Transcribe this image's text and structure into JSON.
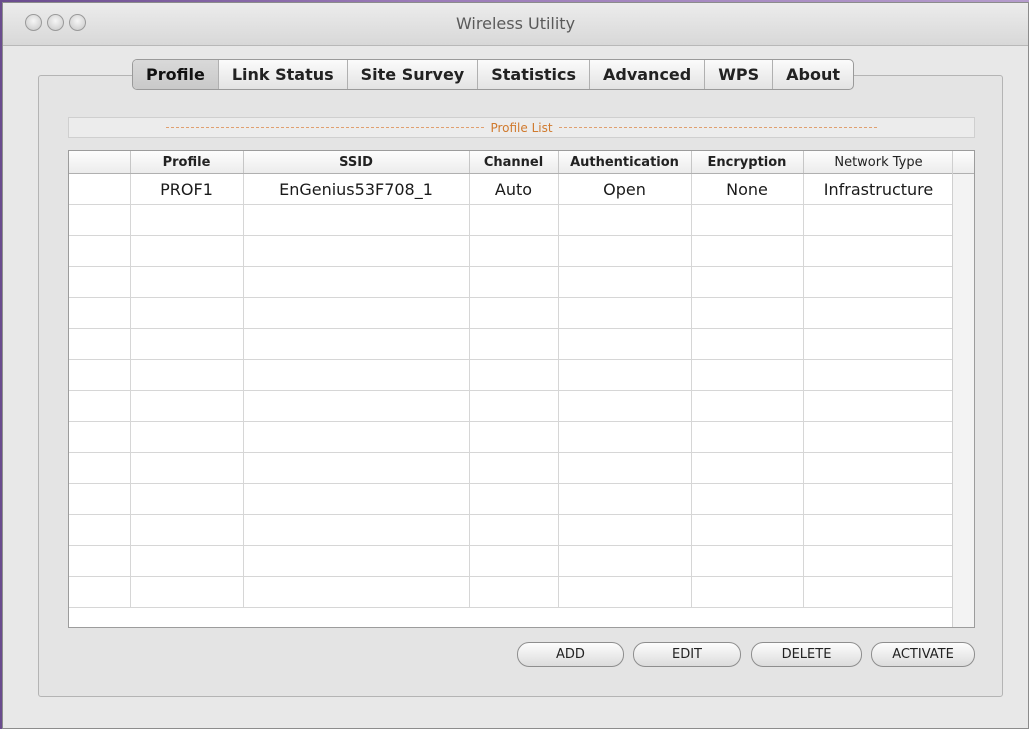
{
  "window": {
    "title": "Wireless Utility"
  },
  "tabs": [
    {
      "label": "Profile",
      "active": true
    },
    {
      "label": "Link Status"
    },
    {
      "label": "Site Survey"
    },
    {
      "label": "Statistics"
    },
    {
      "label": "Advanced"
    },
    {
      "label": "WPS"
    },
    {
      "label": "About"
    }
  ],
  "profile_list": {
    "title": "Profile List",
    "columns": [
      "",
      "Profile",
      "SSID",
      "Channel",
      "Authentication",
      "Encryption",
      "Network Type"
    ],
    "rows": [
      {
        "profile": "PROF1",
        "ssid": "EnGenius53F708_1",
        "channel": "Auto",
        "authentication": "Open",
        "encryption": "None",
        "network_type": "Infrastructure"
      }
    ]
  },
  "buttons": {
    "add": "ADD",
    "edit": "EDIT",
    "delete": "DELETE",
    "activate": "ACTIVATE"
  },
  "colors": {
    "section_title": "#d07a2e",
    "desktop": "#9b7bb8"
  }
}
